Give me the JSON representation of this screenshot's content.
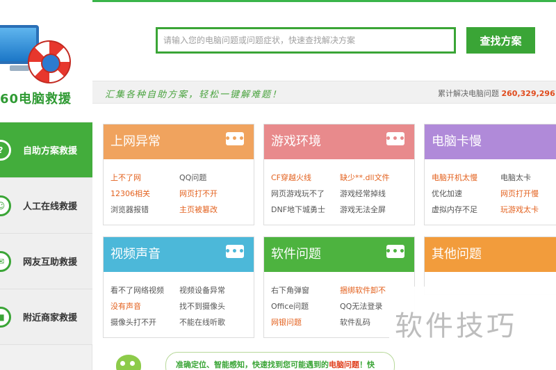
{
  "brand": {
    "name": "60电脑救援"
  },
  "nav": [
    {
      "label": "自助方案救援",
      "icon": "question-icon",
      "active": true
    },
    {
      "label": "人工在线救援",
      "icon": "person-icon",
      "active": false
    },
    {
      "label": "网友互助救援",
      "icon": "chat-icon",
      "active": false
    },
    {
      "label": "附近商家救援",
      "icon": "truck-icon",
      "active": false
    }
  ],
  "search": {
    "placeholder": "请输入您的电脑问题或问题症状，快速查找解决方案",
    "button": "查找方案"
  },
  "slogan": "汇集各种自助方案，轻松一键解难题！",
  "stats": {
    "label": "累计解决电脑问题",
    "value": "260,329,296"
  },
  "cards": [
    {
      "title": "上网异常",
      "items": [
        "上不了网",
        "QQ问题",
        "12306相关",
        "网页打不开",
        "浏览器报错",
        "主页被篡改"
      ]
    },
    {
      "title": "游戏环境",
      "items": [
        "CF穿越火线",
        "缺少**.dll文件",
        "网页游戏玩不了",
        "游戏经常掉线",
        "DNF地下城勇士",
        "游戏无法全屏"
      ]
    },
    {
      "title": "电脑卡慢",
      "items": [
        "电脑开机太慢",
        "电脑太卡",
        "优化加速",
        "网页打开慢",
        "虚拟内存不足",
        "玩游戏太卡"
      ]
    },
    {
      "title": "视频声音",
      "items": [
        "看不了网络视频",
        "视频设备异常",
        "没有声音",
        "找不到摄像头",
        "摄像头打不开",
        "不能在线听歌"
      ]
    },
    {
      "title": "软件问题",
      "items": [
        "右下角弹窗",
        "捆绑软件卸不",
        "Office问题",
        "QQ无法登录",
        "网银问题",
        "软件乱码"
      ]
    },
    {
      "title": "其他问题",
      "items": [
        "",
        "",
        "",
        "",
        "",
        ""
      ]
    }
  ],
  "more_label": "•••",
  "bubble": {
    "text": "准确定位、智能感知，快速找到您可能遇到的",
    "highlight": "电脑问题",
    "tail": "！快"
  },
  "watermark": "软件技巧",
  "colors": {
    "accent": "#3aa536",
    "hot": "#e3611e"
  }
}
